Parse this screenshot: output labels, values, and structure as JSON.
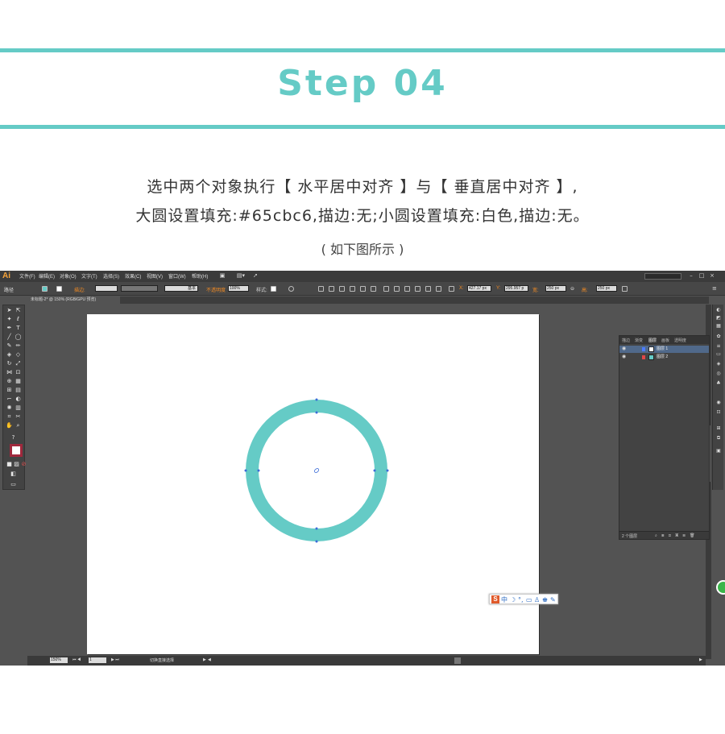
{
  "header": {
    "title": "Step 04",
    "accent_color": "#65cbc6"
  },
  "description": {
    "line1": "选中两个对象执行【 水平居中对齐 】与【 垂直居中对齐 】,",
    "line2": "大圆设置填充:#65cbc6,描边:无;小圆设置填充:白色,描边:无。",
    "caption": "( 如下图所示 )"
  },
  "illustrator": {
    "app_logo": "Ai",
    "menu": [
      "文件(F)",
      "编辑(E)",
      "对象(O)",
      "文字(T)",
      "选择(S)",
      "效果(C)",
      "视图(V)",
      "窗口(W)",
      "帮助(H)"
    ],
    "options_bar": {
      "selection_label": "路径",
      "stroke_label": "描边:",
      "stroke_style": "基本",
      "opacity_label": "不透明度",
      "opacity_value": "100%",
      "style_label": "样式:",
      "x_label": "X:",
      "x_value": "427.17 px",
      "y_label": "Y:",
      "y_value": "295.957 p",
      "w_label": "宽:",
      "w_value": "250 px",
      "h_label": "高:",
      "h_value": "250 px"
    },
    "document_tab": "未标题-2* @ 150% (RGB/GPU 预览)",
    "layers_panel": {
      "tabs": [
        "描边",
        "渐变",
        "图层",
        "画板",
        "透明度"
      ],
      "active_tab": "图层",
      "layers": [
        {
          "name": "图层 1",
          "color": "#4b7bff",
          "selected": true
        },
        {
          "name": "图层 2",
          "color": "#e14747",
          "selected": false
        }
      ],
      "footer": "2 个图层"
    },
    "status_bar": {
      "zoom": "150%",
      "page": "1",
      "tool": "切换直接选择"
    },
    "canvas": {
      "big_circle_fill": "#65cbc6",
      "small_circle_fill": "#ffffff",
      "anchor_color": "#3b6cd8"
    },
    "ime_logo": "S"
  }
}
